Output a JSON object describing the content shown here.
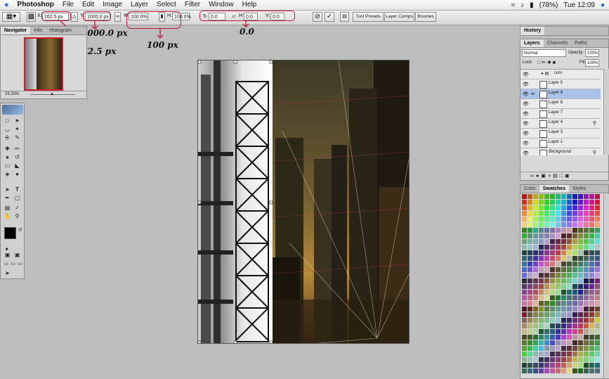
{
  "menubar": {
    "app": "Photoshop",
    "items": [
      "File",
      "Edit",
      "Image",
      "Layer",
      "Select",
      "Filter",
      "Window",
      "Help"
    ],
    "battery": "(78%)",
    "clock": "Tue 12:09"
  },
  "options": {
    "x_label": "X:",
    "x_value": "262.5 px",
    "y_label": "Y:",
    "y_value": "1000.0 px",
    "w_label": "W:",
    "w_value": "100.0%",
    "h_label": "H:",
    "h_value": "100.0%",
    "rot_value": "0.0",
    "hskew_label": "H:",
    "hskew_value": "0.0",
    "vskew_label": "V:",
    "vskew_value": "0.0",
    "tabs": [
      "Tool Presets",
      "Layer Comps",
      "Brushes"
    ]
  },
  "annotations": {
    "y_note": "1000.0 px",
    "x_note": "262.5 px",
    "scale_note": "100 px",
    "angle_note": "0.0"
  },
  "navigator": {
    "tabs": [
      "Navigator",
      "Info",
      "Histogram"
    ],
    "zoom": "33.33%"
  },
  "history": {
    "title": "History"
  },
  "layers": {
    "tabs": [
      "Layers",
      "Channels",
      "Paths"
    ],
    "blend_mode": "Normal",
    "opacity_label": "Opacity:",
    "opacity": "100%",
    "lock_label": "Lock:",
    "fill_label": "Fill:",
    "fill": "100%",
    "rows": [
      "curv",
      "Layer 5",
      "Layer 9",
      "Layer 8",
      "Layer 7",
      "Layer 4",
      "Layer 3",
      "Layer 1",
      "Background"
    ]
  },
  "swatches": {
    "tabs": [
      "Color",
      "Swatches",
      "Styles"
    ]
  },
  "colors": {
    "annotation": "#c3163e",
    "selection": "#a9c2ea"
  }
}
